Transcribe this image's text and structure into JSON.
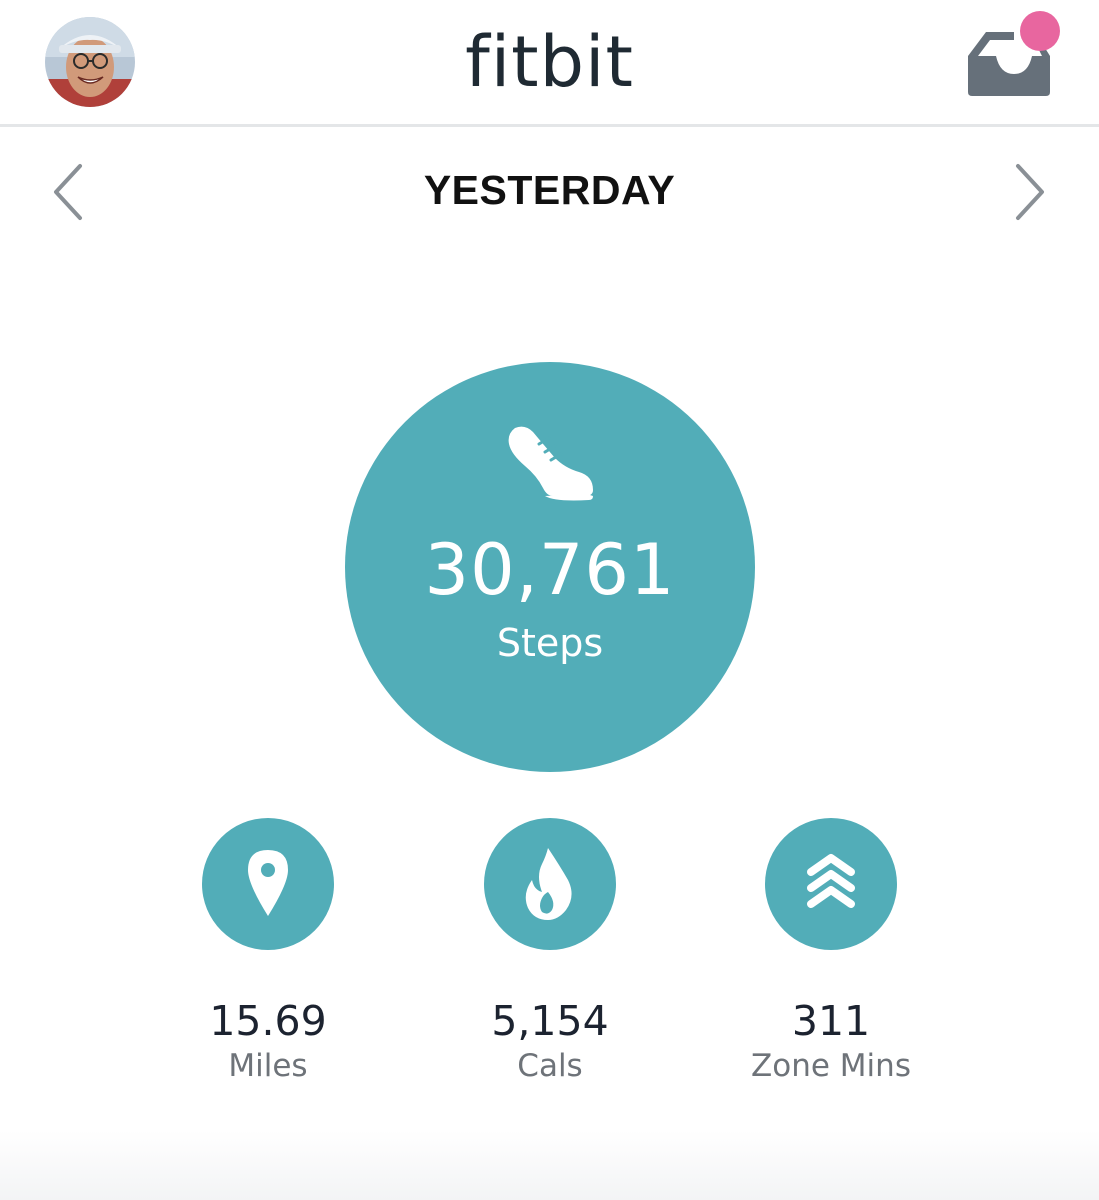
{
  "header": {
    "logo": "fitbit",
    "avatar_icon": "profile-photo",
    "inbox_icon": "inbox-icon",
    "notification_color": "#e8669f"
  },
  "date_nav": {
    "label": "YESTERDAY",
    "prev_icon": "chevron-left-icon",
    "next_icon": "chevron-right-icon"
  },
  "steps": {
    "value": "30,761",
    "label": "Steps",
    "icon": "shoe-icon"
  },
  "stats": [
    {
      "value": "15.69",
      "label": "Miles",
      "icon": "location-pin-icon"
    },
    {
      "value": "5,154",
      "label": "Cals",
      "icon": "flame-icon"
    },
    {
      "value": "311",
      "label": "Zone Mins",
      "icon": "chevrons-up-icon"
    }
  ],
  "colors": {
    "accent": "#52adb8",
    "text": "#1c2330",
    "muted": "#6e7379"
  }
}
